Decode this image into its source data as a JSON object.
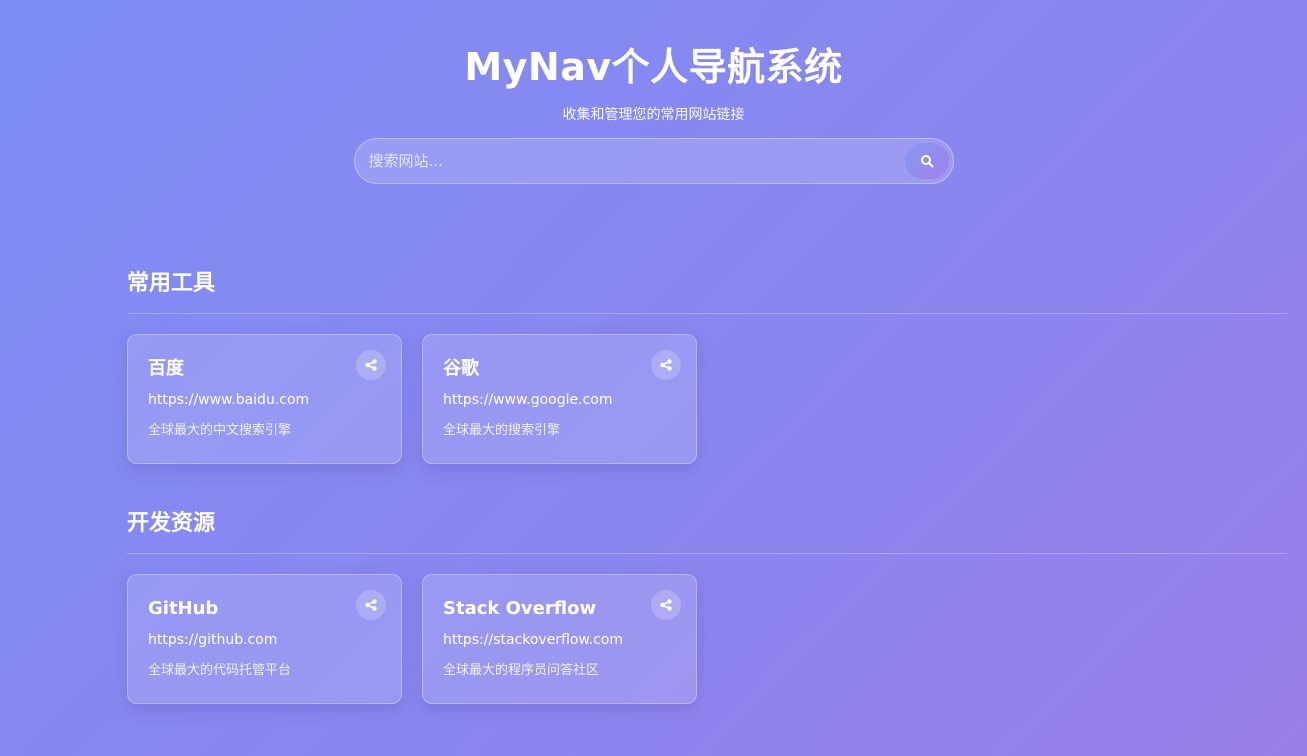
{
  "header": {
    "title": "MyNav个人导航系统",
    "subtitle": "收集和管理您的常用网站链接"
  },
  "search": {
    "placeholder": "搜索网站...",
    "value": "",
    "button_icon": "search-icon"
  },
  "sections": [
    {
      "title": "常用工具",
      "cards": [
        {
          "name": "百度",
          "url": "https://www.baidu.com",
          "desc": "全球最大的中文搜索引擎",
          "action_icon": "share-icon"
        },
        {
          "name": "谷歌",
          "url": "https://www.google.com",
          "desc": "全球最大的搜索引擎",
          "action_icon": "share-icon"
        }
      ]
    },
    {
      "title": "开发资源",
      "cards": [
        {
          "name": "GitHub",
          "url": "https://github.com",
          "desc": "全球最大的代码托管平台",
          "action_icon": "share-icon"
        },
        {
          "name": "Stack Overflow",
          "url": "https://stackoverflow.com",
          "desc": "全球最大的程序员问答社区",
          "action_icon": "share-icon"
        }
      ]
    }
  ],
  "colors": {
    "background_start": "#7d8ef5",
    "background_end": "#9a7fe8",
    "text": "#ffffff"
  }
}
